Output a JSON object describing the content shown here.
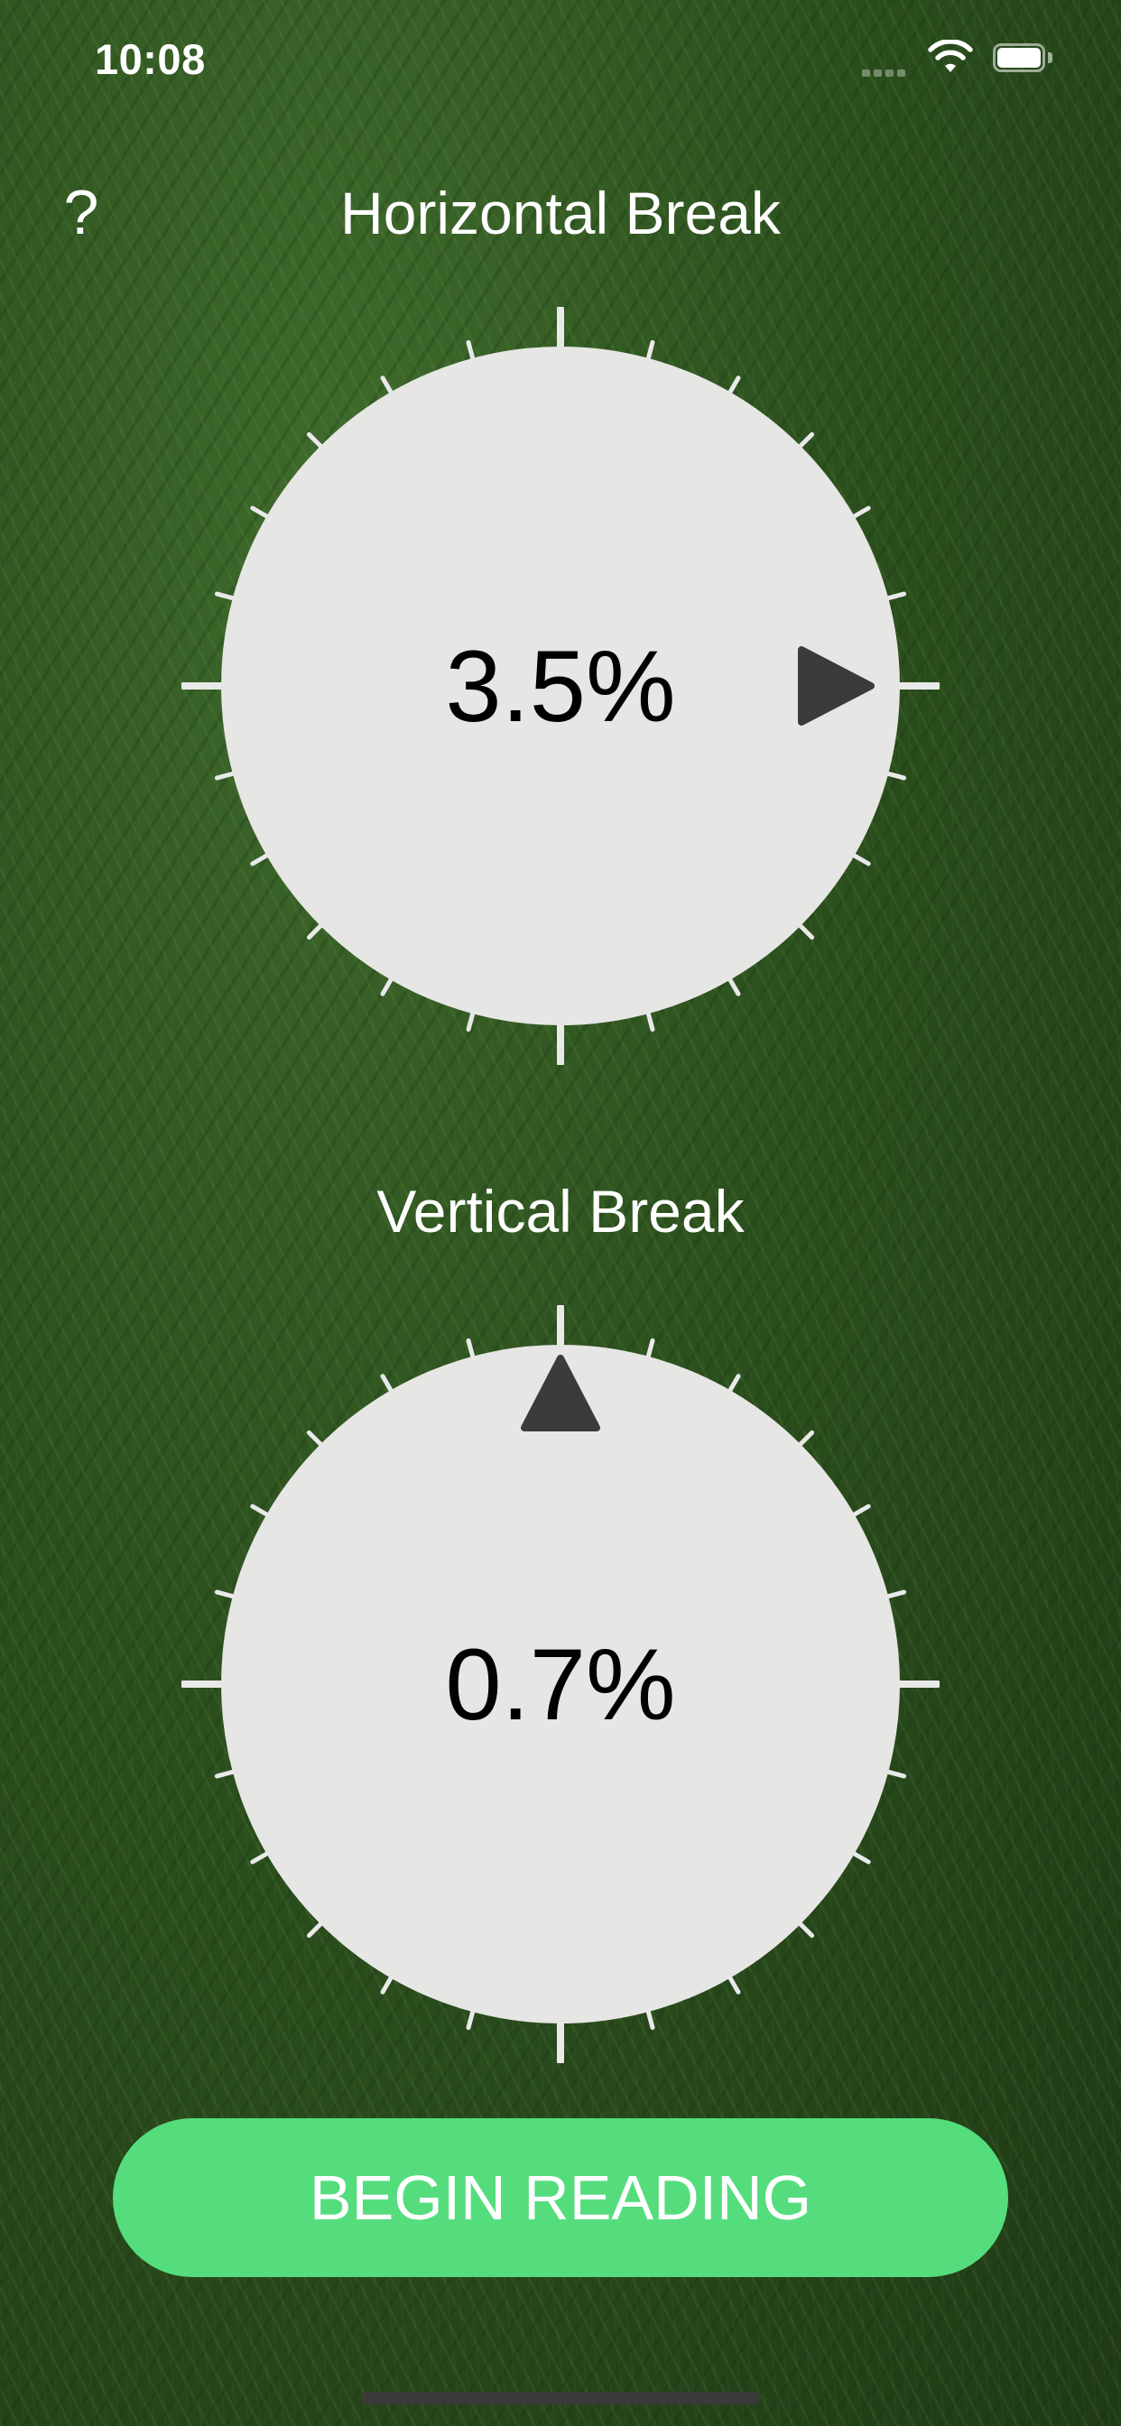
{
  "status_bar": {
    "time": "10:08",
    "wifi_icon": "wifi-icon",
    "battery_icon": "battery-icon"
  },
  "help_button": {
    "label": "?",
    "icon": "help-icon"
  },
  "horizontal": {
    "label": "Horizontal Break",
    "value": "3.5%",
    "pointer_direction": "right"
  },
  "vertical": {
    "label": "Vertical Break",
    "value": "0.7%",
    "pointer_direction": "up"
  },
  "begin_button": {
    "label": "BEGIN READING"
  },
  "colors": {
    "button": "#55dd7d",
    "dial_face": "#e6e6e4",
    "pointer": "#3b3b3b",
    "tick": "#e9e9e9"
  }
}
